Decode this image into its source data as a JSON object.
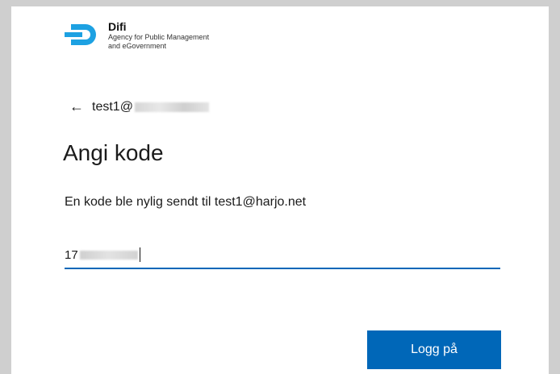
{
  "logo": {
    "name": "Difi",
    "subtitle_line1": "Agency for Public Management",
    "subtitle_line2": "and eGovernment",
    "brand_color": "#1da1e2"
  },
  "account": {
    "back_icon": "arrow-left-icon",
    "email_prefix": "test1@"
  },
  "page": {
    "title": "Angi kode",
    "description": "En kode ble nylig sendt til test1@harjo.net"
  },
  "code_input": {
    "value_prefix": "17"
  },
  "actions": {
    "login_label": "Logg på",
    "accent_color": "#0067b8"
  }
}
